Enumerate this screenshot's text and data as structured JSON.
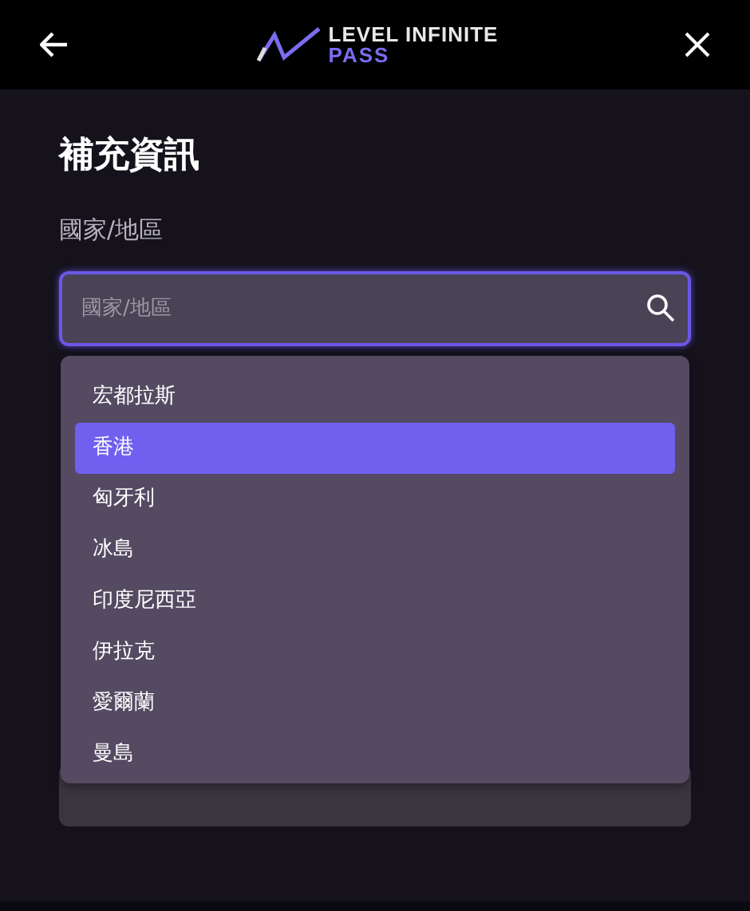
{
  "header": {
    "logo_top": "LEVEL INFINITE",
    "logo_bottom": "PASS"
  },
  "title": "補充資訊",
  "field": {
    "label": "國家/地區",
    "placeholder": "國家/地區"
  },
  "options": [
    {
      "label": "宏都拉斯",
      "selected": false
    },
    {
      "label": "香港",
      "selected": true
    },
    {
      "label": "匈牙利",
      "selected": false
    },
    {
      "label": "冰島",
      "selected": false
    },
    {
      "label": "印度尼西亞",
      "selected": false
    },
    {
      "label": "伊拉克",
      "selected": false
    },
    {
      "label": "愛爾蘭",
      "selected": false
    },
    {
      "label": "曼島",
      "selected": false
    }
  ]
}
